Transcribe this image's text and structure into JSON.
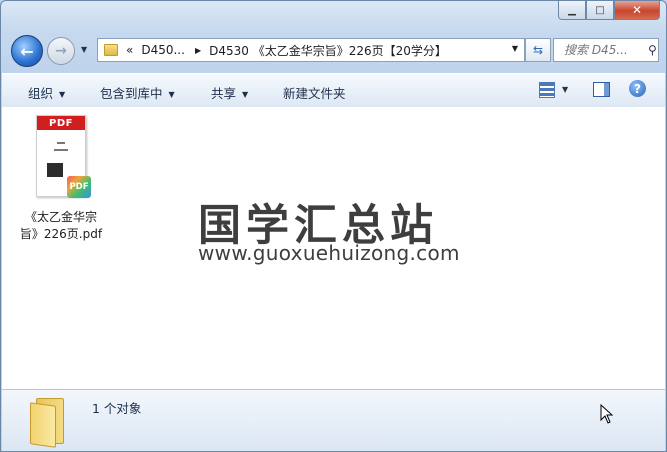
{
  "address": {
    "overflow_glyph": "«",
    "segments": [
      "D450...",
      "D4530 《太乙金华宗旨》226页【20学分】"
    ]
  },
  "search": {
    "placeholder": "搜索 D45..."
  },
  "toolbar": {
    "organize": "组织",
    "include_in_library": "包含到库中",
    "share": "共享",
    "new_folder": "新建文件夹"
  },
  "file": {
    "thumb_band": "PDF",
    "badge": "PDF",
    "name_line1": "《太乙金华宗",
    "name_line2": "旨》226页.pdf"
  },
  "watermark": {
    "title": "国学汇总站",
    "url": "www.guoxuehuizong.com"
  },
  "details": {
    "count": "1 个对象"
  },
  "icons": {
    "back": "back-arrow-icon",
    "forward": "forward-arrow-icon",
    "refresh": "refresh-icon",
    "search": "search-icon",
    "help": "help-icon"
  },
  "colors": {
    "pdf_red": "#d11f1f",
    "back_blue": "#2a6fd0",
    "close_red": "#c8452c"
  }
}
